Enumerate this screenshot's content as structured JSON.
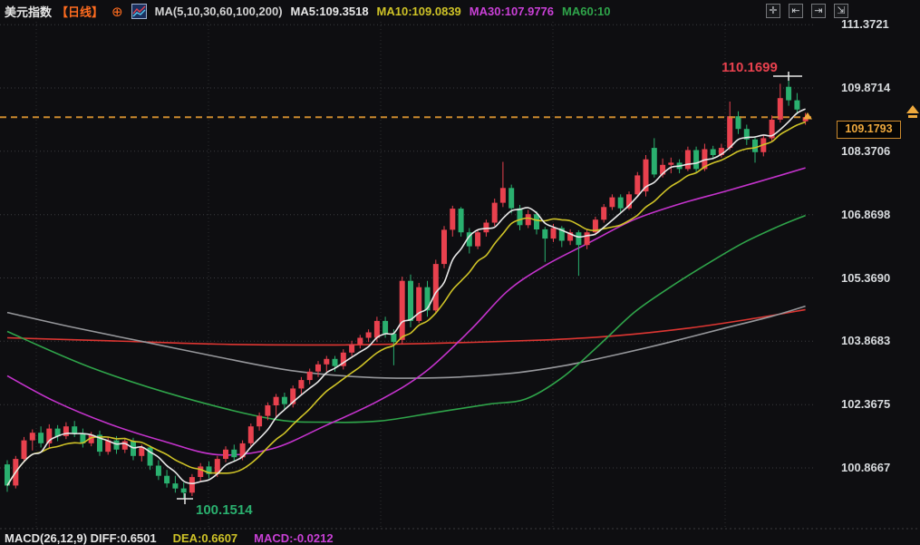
{
  "header": {
    "symbol": "美元指数",
    "period_tag": "【日线】",
    "add_icon": "⊕",
    "ma_group_label": "MA(5,10,30,60,100,200)",
    "ma5_label": "MA5:109.3518",
    "ma10_label": "MA10:109.0839",
    "ma30_label": "MA30:107.9776",
    "ma60_label": "MA60:10"
  },
  "toolbar": {
    "buttons": [
      {
        "name": "pan-button",
        "glyph": "✛"
      },
      {
        "name": "scale-left-button",
        "glyph": "⇤"
      },
      {
        "name": "scale-right-button",
        "glyph": "⇥"
      },
      {
        "name": "detach-pane-button",
        "glyph": "⇲"
      }
    ]
  },
  "price_axis": {
    "labels": [
      "111.3721",
      "109.8714",
      "108.3706",
      "106.8698",
      "105.3690",
      "103.8683",
      "102.3675",
      "100.8667"
    ],
    "current_price_label": "109.1793"
  },
  "annotations": {
    "high_label": "110.1699",
    "low_label": "100.1514"
  },
  "macd_row": {
    "indicator": "MACD(26,12,9) DIFF:0.6501",
    "dea": "DEA:0.6607",
    "macd": "MACD:-0.0212"
  },
  "colors": {
    "background": "#0e0e11",
    "up_candle": "#e8414e",
    "down_candle": "#2ab06f",
    "ma5": "#e8e8e8",
    "ma10": "#cfc327",
    "ma30": "#c433cc",
    "ma60": "#2fa44a",
    "ma100": "#96979b",
    "ma200": "#dd3632",
    "price_line": "#cb8a2e",
    "badge_text": "#efa93d",
    "high_text": "#e8414e",
    "low_text": "#2ab06f",
    "grid": "#3a3b3f"
  },
  "chart_data": {
    "type": "candlestick",
    "title": "美元指数 日线 (US Dollar Index, daily)",
    "legend_values": {
      "ma5": 109.3518,
      "ma10": 109.0839,
      "ma30": 107.9776
    },
    "price_axis_ticks": [
      111.3721,
      109.8714,
      108.3706,
      106.8698,
      105.369,
      103.8683,
      102.3675,
      100.8667
    ],
    "current_price": 109.1793,
    "high": 110.1699,
    "low": 100.1514,
    "grid": "dotted",
    "candles_ohlc": [
      [
        100.95,
        101.05,
        100.3,
        100.45
      ],
      [
        100.45,
        101.15,
        100.38,
        101.08
      ],
      [
        101.08,
        101.6,
        101.0,
        101.52
      ],
      [
        101.52,
        101.78,
        101.28,
        101.7
      ],
      [
        101.7,
        101.85,
        101.35,
        101.45
      ],
      [
        101.45,
        101.9,
        101.35,
        101.8
      ],
      [
        101.8,
        101.88,
        101.5,
        101.62
      ],
      [
        101.62,
        101.95,
        101.55,
        101.85
      ],
      [
        101.85,
        101.98,
        101.6,
        101.68
      ],
      [
        101.68,
        101.8,
        101.35,
        101.45
      ],
      [
        101.45,
        101.72,
        101.38,
        101.65
      ],
      [
        101.65,
        101.75,
        101.15,
        101.25
      ],
      [
        101.25,
        101.6,
        101.18,
        101.52
      ],
      [
        101.52,
        101.62,
        101.2,
        101.3
      ],
      [
        101.3,
        101.58,
        101.22,
        101.5
      ],
      [
        101.5,
        101.58,
        101.05,
        101.15
      ],
      [
        101.15,
        101.42,
        101.02,
        101.35
      ],
      [
        101.35,
        101.4,
        100.82,
        100.92
      ],
      [
        100.92,
        101.05,
        100.58,
        100.68
      ],
      [
        100.68,
        100.82,
        100.4,
        100.5
      ],
      [
        100.5,
        100.68,
        100.28,
        100.38
      ],
      [
        100.38,
        100.52,
        100.1514,
        100.28
      ],
      [
        100.28,
        100.72,
        100.2,
        100.65
      ],
      [
        100.65,
        100.98,
        100.55,
        100.9
      ],
      [
        100.9,
        101.02,
        100.62,
        100.72
      ],
      [
        100.72,
        101.15,
        100.65,
        101.08
      ],
      [
        101.08,
        101.38,
        101.0,
        101.3
      ],
      [
        101.3,
        101.42,
        101.02,
        101.12
      ],
      [
        101.12,
        101.52,
        101.05,
        101.45
      ],
      [
        101.45,
        101.92,
        101.38,
        101.85
      ],
      [
        101.85,
        102.18,
        101.75,
        102.1
      ],
      [
        102.1,
        102.42,
        102.0,
        102.35
      ],
      [
        102.35,
        102.62,
        102.05,
        102.55
      ],
      [
        102.55,
        102.65,
        102.25,
        102.38
      ],
      [
        102.38,
        102.82,
        102.3,
        102.75
      ],
      [
        102.75,
        103.02,
        102.62,
        102.95
      ],
      [
        102.95,
        103.22,
        102.85,
        103.15
      ],
      [
        103.15,
        103.4,
        103.02,
        103.32
      ],
      [
        103.32,
        103.52,
        103.15,
        103.45
      ],
      [
        103.45,
        103.52,
        103.15,
        103.28
      ],
      [
        103.28,
        103.68,
        103.2,
        103.6
      ],
      [
        103.6,
        103.88,
        103.52,
        103.8
      ],
      [
        103.8,
        104.02,
        103.7,
        103.95
      ],
      [
        103.95,
        104.15,
        103.85,
        104.08
      ],
      [
        103.95,
        104.45,
        103.85,
        104.35
      ],
      [
        104.35,
        104.45,
        103.95,
        104.05
      ],
      [
        104.05,
        104.15,
        103.3,
        103.85
      ],
      [
        103.9,
        105.4,
        103.8,
        105.3
      ],
      [
        105.3,
        105.45,
        104.2,
        104.35
      ],
      [
        104.35,
        105.25,
        104.3,
        105.15
      ],
      [
        105.15,
        105.3,
        104.45,
        104.6
      ],
      [
        104.6,
        105.8,
        104.55,
        105.7
      ],
      [
        105.7,
        106.6,
        105.6,
        106.51
      ],
      [
        106.51,
        107.08,
        106.35,
        107.01
      ],
      [
        107.01,
        107.05,
        106.35,
        106.45
      ],
      [
        106.45,
        106.55,
        105.95,
        106.12
      ],
      [
        106.12,
        106.52,
        106.05,
        106.45
      ],
      [
        106.45,
        106.75,
        106.35,
        106.68
      ],
      [
        106.68,
        107.25,
        106.6,
        107.15
      ],
      [
        107.15,
        108.12,
        107.05,
        107.5
      ],
      [
        107.5,
        107.58,
        106.9,
        107.02
      ],
      [
        107.02,
        107.1,
        106.5,
        106.62
      ],
      [
        106.62,
        106.98,
        106.55,
        106.88
      ],
      [
        106.88,
        106.95,
        106.4,
        106.52
      ],
      [
        106.52,
        106.58,
        105.75,
        106.3
      ],
      [
        106.3,
        106.65,
        106.22,
        106.55
      ],
      [
        106.55,
        106.6,
        106.1,
        106.25
      ],
      [
        106.25,
        106.52,
        106.15,
        106.45
      ],
      [
        106.45,
        106.5,
        105.42,
        106.15
      ],
      [
        106.15,
        106.52,
        106.05,
        106.45
      ],
      [
        106.45,
        106.82,
        106.38,
        106.75
      ],
      [
        106.75,
        107.12,
        106.68,
        107.05
      ],
      [
        107.05,
        107.35,
        106.98,
        107.28
      ],
      [
        107.28,
        107.35,
        106.92,
        107.02
      ],
      [
        107.02,
        107.42,
        106.98,
        107.35
      ],
      [
        107.35,
        107.88,
        107.28,
        107.8
      ],
      [
        107.42,
        108.28,
        107.3,
        108.18
      ],
      [
        108.45,
        108.68,
        107.75,
        107.82
      ],
      [
        107.82,
        108.2,
        107.75,
        108.05
      ],
      [
        108.05,
        108.22,
        107.85,
        108.1
      ],
      [
        108.1,
        108.18,
        107.85,
        107.95
      ],
      [
        107.95,
        108.48,
        107.9,
        108.4
      ],
      [
        108.4,
        108.48,
        107.85,
        107.95
      ],
      [
        107.95,
        108.55,
        107.9,
        108.42
      ],
      [
        108.42,
        108.5,
        108.18,
        108.28
      ],
      [
        108.28,
        108.55,
        108.22,
        108.45
      ],
      [
        108.45,
        109.55,
        108.4,
        109.2
      ],
      [
        109.2,
        109.32,
        108.78,
        108.9
      ],
      [
        108.9,
        109.0,
        108.52,
        108.65
      ],
      [
        108.65,
        108.7,
        108.1,
        108.35
      ],
      [
        108.35,
        108.75,
        108.25,
        108.68
      ],
      [
        108.68,
        109.22,
        108.6,
        109.12
      ],
      [
        109.12,
        109.97,
        109.05,
        109.63
      ],
      [
        109.9,
        110.1699,
        109.45,
        109.58
      ],
      [
        109.58,
        109.75,
        109.25,
        109.36
      ],
      [
        109.08,
        109.28,
        109.0,
        109.1793
      ]
    ],
    "ma_anchor_lines": {
      "ma30": [
        [
          0,
          103.05
        ],
        [
          5.6,
          102.45
        ],
        [
          12,
          101.92
        ],
        [
          18.6,
          101.5
        ],
        [
          25,
          101.18
        ],
        [
          31.5,
          101.32
        ],
        [
          38,
          101.88
        ],
        [
          44.4,
          102.48
        ],
        [
          49.8,
          103.15
        ],
        [
          55.2,
          104.15
        ],
        [
          59.5,
          105.05
        ],
        [
          63.9,
          105.65
        ],
        [
          69.2,
          106.2
        ],
        [
          74.6,
          106.75
        ],
        [
          80,
          107.12
        ],
        [
          85.4,
          107.42
        ],
        [
          90.3,
          107.7
        ],
        [
          95,
          107.9776
        ]
      ],
      "ma60": [
        [
          0,
          104.1
        ],
        [
          9.9,
          103.25
        ],
        [
          20.7,
          102.55
        ],
        [
          31.5,
          102.03
        ],
        [
          38,
          101.95
        ],
        [
          44.4,
          101.98
        ],
        [
          50.9,
          102.18
        ],
        [
          57.4,
          102.38
        ],
        [
          61.7,
          102.5
        ],
        [
          66,
          103.0
        ],
        [
          70.3,
          103.75
        ],
        [
          74.6,
          104.55
        ],
        [
          78.9,
          105.15
        ],
        [
          83.3,
          105.7
        ],
        [
          87.6,
          106.2
        ],
        [
          91.9,
          106.6
        ],
        [
          95,
          106.85
        ]
      ],
      "ma100": [
        [
          0,
          104.55
        ],
        [
          7.8,
          104.2
        ],
        [
          16.4,
          103.85
        ],
        [
          25,
          103.5
        ],
        [
          33.6,
          103.18
        ],
        [
          42.3,
          103.02
        ],
        [
          50.9,
          103.0
        ],
        [
          59.5,
          103.1
        ],
        [
          66,
          103.28
        ],
        [
          72.5,
          103.55
        ],
        [
          78.9,
          103.85
        ],
        [
          85.4,
          104.18
        ],
        [
          90.8,
          104.45
        ],
        [
          95,
          104.7
        ]
      ],
      "ma200": [
        [
          0,
          103.95
        ],
        [
          12.1,
          103.88
        ],
        [
          25,
          103.8
        ],
        [
          38,
          103.78
        ],
        [
          50.9,
          103.82
        ],
        [
          63.9,
          103.9
        ],
        [
          72.5,
          104.0
        ],
        [
          81.1,
          104.18
        ],
        [
          88.6,
          104.4
        ],
        [
          95,
          104.62
        ]
      ]
    }
  }
}
